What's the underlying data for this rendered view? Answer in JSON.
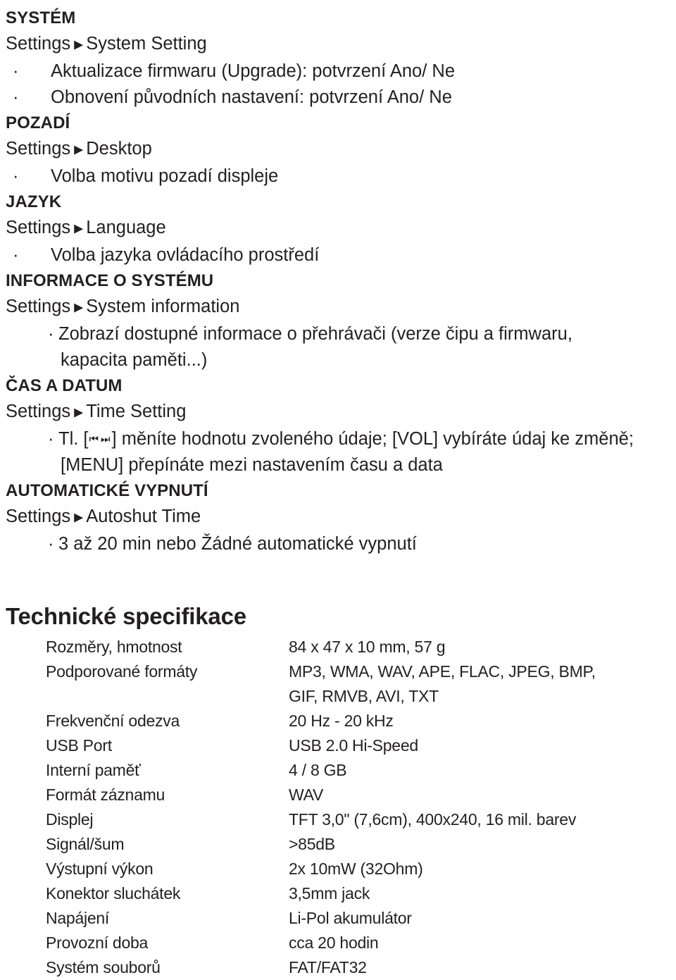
{
  "menu_sections": [
    {
      "title": "SYSTÉM",
      "path_root": "Settings",
      "path_leaf": "System Setting",
      "bullets": [
        "Aktualizace firmwaru (Upgrade): potvrzení Ano/ Ne",
        "Obnovení původních nastavení: potvrzení Ano/ Ne"
      ]
    },
    {
      "title": "POZADÍ",
      "path_root": "Settings",
      "path_leaf": "Desktop",
      "bullets": [
        "Volba motivu pozadí displeje"
      ]
    },
    {
      "title": "JAZYK",
      "path_root": "Settings",
      "path_leaf": "Language",
      "bullets": [
        "Volba jazyka ovládacího prostředí"
      ]
    },
    {
      "title": "INFORMACE O SYSTÉMU",
      "path_root": "Settings",
      "path_leaf": "System information",
      "bullets": [
        "Zobrazí dostupné informace o přehrávači (verze čipu a firmwaru,"
      ],
      "continuation": "kapacita paměti...)"
    },
    {
      "title": "ČAS A DATUM",
      "path_root": "Settings",
      "path_leaf": "Time Setting",
      "bullets": [
        "Tl. [⏮ ⏭] měníte hodnotu zvoleného údaje; [VOL] vybíráte údaj ke změně;"
      ],
      "continuation": "[MENU] přepínáte mezi nastavením času a data"
    },
    {
      "title": "AUTOMATICKÉ VYPNUTÍ",
      "path_root": "Settings",
      "path_leaf": "Autoshut Time",
      "bullets": [
        "3 až 20 min nebo Žádné automatické vypnutí"
      ]
    }
  ],
  "menu_text": {
    "bullet_glyph": "·",
    "path_separator": "▶",
    "time_bullet_prefix": "Tl. [",
    "time_glyph_prev": "⏮",
    "time_glyph_next": "⏭",
    "time_bullet_suffix": "] měníte hodnotu zvoleného údaje; [VOL] vybíráte údaj ke změně;"
  },
  "specs": {
    "title": "Technické specifikace",
    "rows": [
      {
        "label": "Rozměry, hmotnost",
        "value": "84 x 47 x 10 mm, 57 g",
        "value2": ""
      },
      {
        "label": "Podporované formáty",
        "value": "MP3, WMA, WAV, APE, FLAC, JPEG, BMP,",
        "value2": "GIF, RMVB, AVI, TXT"
      },
      {
        "label": "Frekvenční odezva",
        "value": "20 Hz - 20 kHz",
        "value2": ""
      },
      {
        "label": "USB Port",
        "value": "USB 2.0 Hi-Speed",
        "value2": ""
      },
      {
        "label": "Interní paměť",
        "value": "4 / 8 GB",
        "value2": ""
      },
      {
        "label": "Formát záznamu",
        "value": "WAV",
        "value2": ""
      },
      {
        "label": "Displej",
        "value": "TFT 3,0\" (7,6cm), 400x240, 16 mil. barev",
        "value2": ""
      },
      {
        "label": "Signál/šum",
        "value": ">85dB",
        "value2": ""
      },
      {
        "label": "Výstupní výkon",
        "value": "2x 10mW (32Ohm)",
        "value2": ""
      },
      {
        "label": "Konektor sluchátek",
        "value": "3,5mm jack",
        "value2": ""
      },
      {
        "label": "Napájení",
        "value": "Li-Pol akumulátor",
        "value2": ""
      },
      {
        "label": "Provozní doba",
        "value": "cca 20 hodin",
        "value2": ""
      },
      {
        "label": "Systém souborů",
        "value": "FAT/FAT32",
        "value2": ""
      }
    ]
  },
  "colors": {
    "text": "#231f20",
    "background": "#ffffff"
  }
}
